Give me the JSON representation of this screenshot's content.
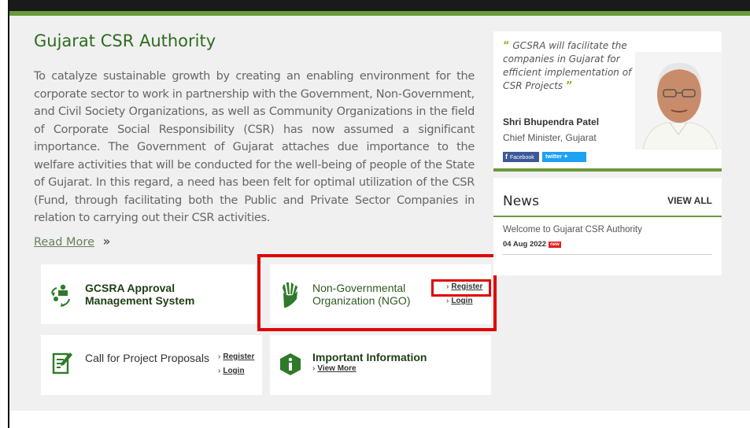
{
  "main": {
    "title": "Gujarat CSR Authority",
    "intro": "To catalyze sustainable growth by creating an enabling environment for the corporate sector to work in partnership with the Government, Non-Government, and Civil Society Organizations, as well as Community Organizations in the field of Corporate Social Responsibility (CSR) has now assumed a significant importance. The Government of Gujarat attaches due importance to the welfare activities that will be conducted for the well-being of people of the State of Gujarat. In this regard, a need has been felt for optimal utilization of the CSR (Fund, through facilitating both the Public and Private Sector Companies in relation to carrying out their CSR activities.",
    "read_more": "Read More",
    "read_more_arrow": "»"
  },
  "cards": {
    "approval": {
      "line1": "GCSRA Approval",
      "line2": "Management System"
    },
    "ngo": {
      "line1": "Non-Governmental",
      "line2": "Organization (NGO)",
      "register": "Register",
      "login": "Login"
    },
    "proposals": {
      "title": "Call for Project Proposals",
      "register": "Register",
      "login": "Login"
    },
    "info": {
      "title": "Important Information",
      "view_more": "View More"
    }
  },
  "quote": {
    "open": "“",
    "text": "GCSRA will facilitate the companies in Gujarat for efficient implementation of CSR Projects",
    "close": "”",
    "name": "Shri Bhupendra Patel",
    "role": "Chief Minister, Gujarat",
    "facebook": "Facebook",
    "twitter": "twitter"
  },
  "news": {
    "heading": "News",
    "view_all": "VIEW ALL",
    "items": [
      {
        "title": "Welcome to Gujarat CSR Authority",
        "date": "04 Aug 2022",
        "badge": "new"
      }
    ]
  },
  "icons": {
    "approval": "recycle-people-icon",
    "ngo": "hands-icon",
    "proposals": "edit-document-icon",
    "info": "info-hexagon-icon"
  },
  "colors": {
    "brand_green": "#6a9a3a",
    "title_green": "#2e6b1f",
    "highlight_red": "#e00000"
  }
}
